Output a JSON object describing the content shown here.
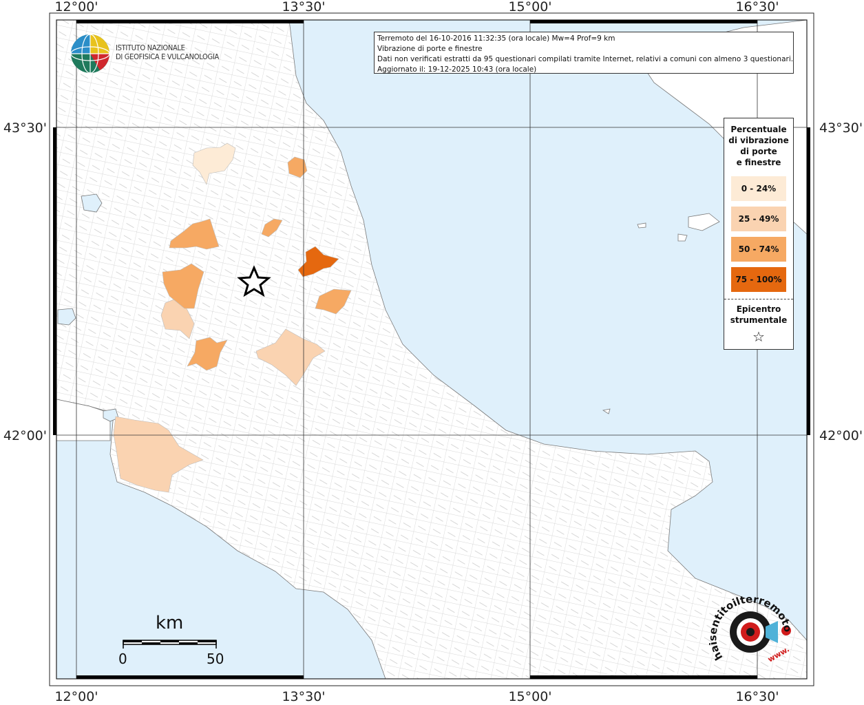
{
  "map": {
    "axis_labels": {
      "lon_top": [
        "12°00'",
        "13°30'",
        "15°00'",
        "16°30'"
      ],
      "lon_bottom": [
        "12°00'",
        "13°30'",
        "15°00'",
        "16°30'"
      ],
      "lat_left": [
        "43°30'",
        "42°00'"
      ],
      "lat_right": [
        "43°30'",
        "42°00'"
      ]
    },
    "colors": {
      "sea": "#dff0fb",
      "land": "#ffffff",
      "border": "#b5b5b5",
      "class_0_24": "#fdebd6",
      "class_25_49": "#fad3b1",
      "class_50_74": "#f6a963",
      "class_75_100": "#e5680f"
    }
  },
  "info": {
    "line1": "Terremoto del 16-10-2016 11:32:35 (ora locale) Mw=4 Prof=9 km",
    "line2": "Vibrazione di porte e finestre",
    "line3": "Dati non verificati estratti da 95 questionari compilati tramite Internet, relativi a comuni con almeno 3 questionari.",
    "line4": "Aggiornato il: 19-12-2025 10:43 (ora locale)"
  },
  "legend": {
    "title_lines": [
      "Percentuale",
      "di vibrazione",
      "di porte",
      "e finestre"
    ],
    "items": [
      {
        "label": "0 - 24%",
        "color": "#fdebd6"
      },
      {
        "label": "25 - 49%",
        "color": "#fad3b1"
      },
      {
        "label": "50 - 74%",
        "color": "#f6a963"
      },
      {
        "label": "75 - 100%",
        "color": "#e5680f"
      }
    ],
    "epicenter_lines": [
      "Epicentro",
      "strumentale"
    ]
  },
  "ingv": {
    "line1": "ISTITUTO NAZIONALE",
    "line2": "DI GEOFISICA E VULCANOLOGIA"
  },
  "scale": {
    "unit": "km",
    "start": "0",
    "end": "50"
  },
  "hst": {
    "text": "haisentitoilterremoto.it",
    "url_text": "www."
  }
}
